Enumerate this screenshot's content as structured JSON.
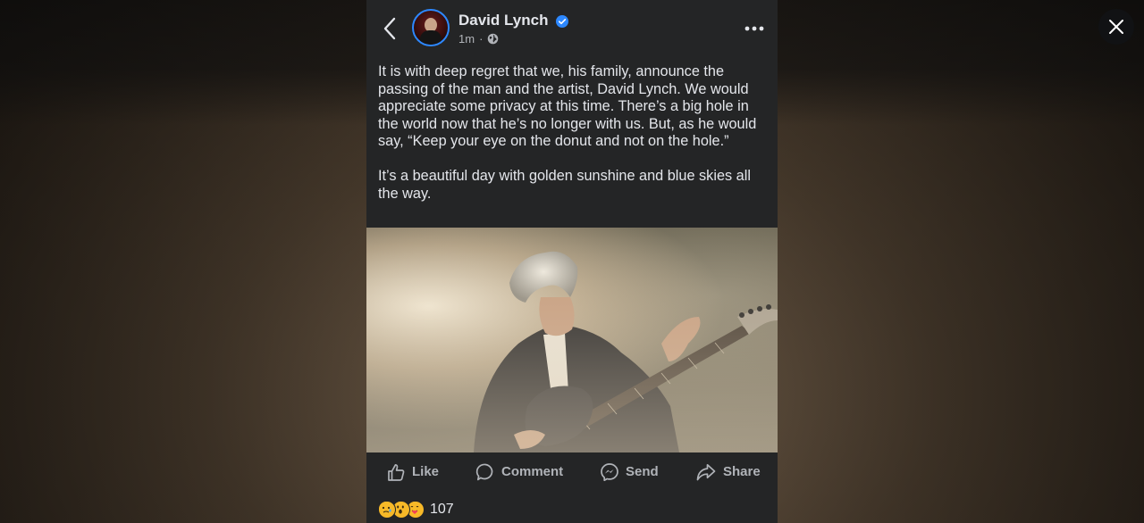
{
  "post": {
    "author": "David Lynch",
    "verified": true,
    "timestamp": "1m",
    "audience": "globe-icon",
    "paragraphs": [
      "It is with deep regret that we, his family, announce the passing of the man and the artist, David Lynch.  We would appreciate some privacy at this time.  There’s a big hole in the world now that he’s no longer with us.  But, as he would say, “Keep your eye on the donut and not on the hole.”",
      "It’s a beautiful day with golden sunshine and blue skies all the way."
    ],
    "image_alt": "",
    "actions": {
      "like": "Like",
      "comment": "Comment",
      "send": "Send",
      "share": "Share"
    },
    "reactions": {
      "types": [
        "sad",
        "wow",
        "care"
      ],
      "count": "107"
    }
  },
  "colors": {
    "card_bg": "#242526",
    "text_primary": "#e4e6eb",
    "text_secondary": "#b0b3b8",
    "accent": "#2d88ff"
  }
}
